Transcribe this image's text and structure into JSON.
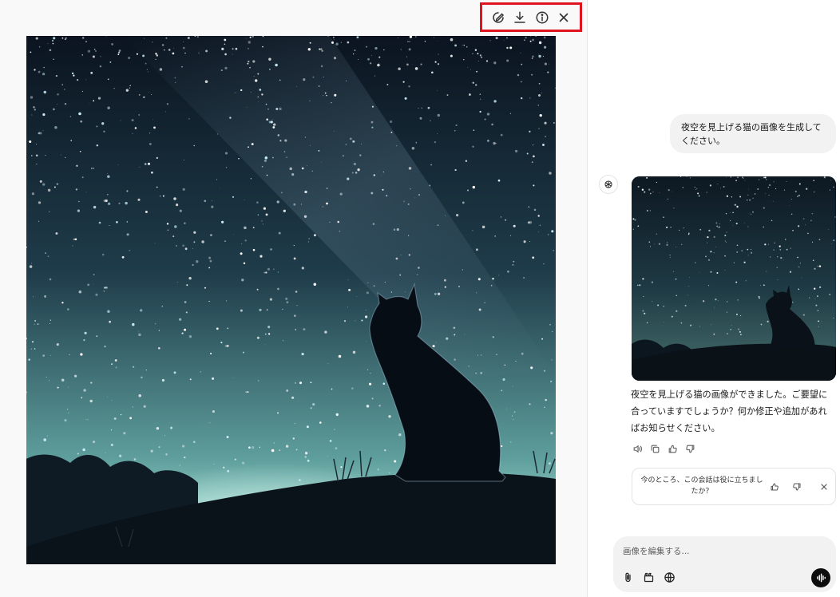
{
  "viewer": {
    "toolbar": {
      "icons": [
        "edit-image-icon",
        "download-icon",
        "info-icon",
        "close-icon"
      ]
    },
    "image": {
      "subject": "cat silhouette looking up at starry night sky"
    }
  },
  "chat": {
    "user_message": "夜空を見上げる猫の画像を生成してください。",
    "assistant_message": "夜空を見上げる猫の画像ができました。ご要望に合っていますでしょうか？何か修正や追加があればお知らせください。",
    "message_actions": [
      "read-aloud-icon",
      "copy-icon",
      "thumbs-up-icon",
      "thumbs-down-icon"
    ],
    "feedback": {
      "text": "今のところ、この会話は役に立ちましたか？"
    },
    "composer": {
      "placeholder": "画像を編集する..."
    }
  },
  "colors": {
    "highlight": "#e0141e",
    "bubble": "#f2f2f2",
    "sky_top": "#0b1420",
    "sky_glow": "#8fcfc8"
  }
}
